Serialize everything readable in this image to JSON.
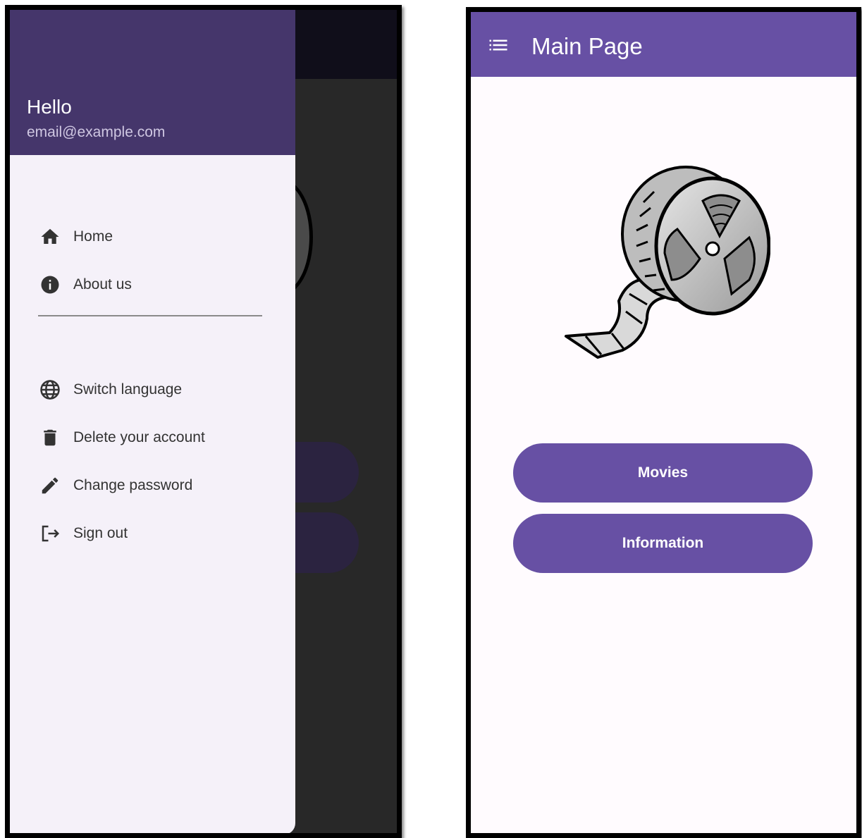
{
  "drawer": {
    "header": {
      "greeting": "Hello",
      "email": "email@example.com"
    },
    "primary_items": [
      {
        "label": "Home",
        "icon": "home-icon"
      },
      {
        "label": "About us",
        "icon": "info-icon"
      }
    ],
    "secondary_items": [
      {
        "label": "Switch language",
        "icon": "globe-icon"
      },
      {
        "label": "Delete your account",
        "icon": "trash-icon"
      },
      {
        "label": "Change password",
        "icon": "pencil-icon"
      },
      {
        "label": "Sign out",
        "icon": "sign-out-icon"
      }
    ]
  },
  "main": {
    "appbar": {
      "title": "Main Page",
      "menu_icon": "menu-icon"
    },
    "illustration": "film-reel-icon",
    "buttons": [
      {
        "label": "Movies"
      },
      {
        "label": "Information"
      }
    ]
  },
  "colors": {
    "primary": "#6750a4",
    "drawer_header": "#45366b",
    "drawer_bg": "#f5f1f9",
    "scrim": "#282828",
    "page_bg": "#fffbfe"
  }
}
